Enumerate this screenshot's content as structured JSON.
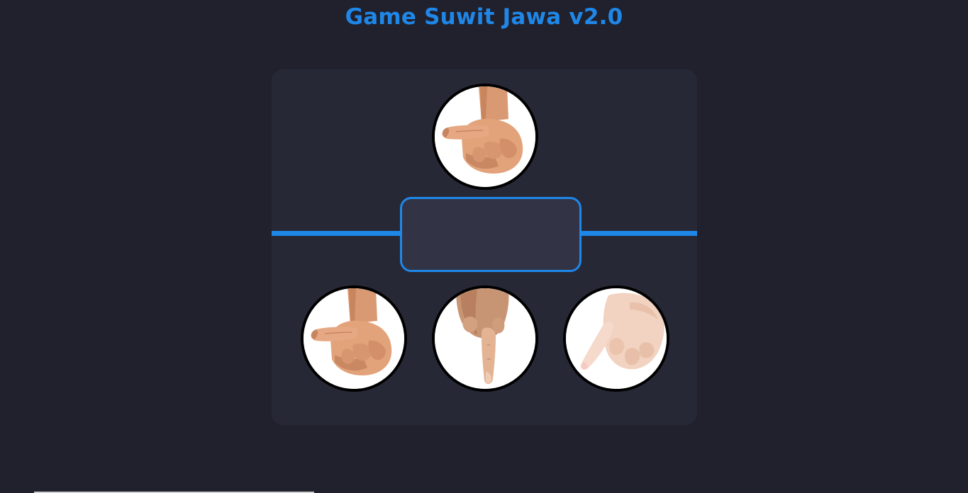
{
  "header": {
    "title": "Game Suwit Jawa v2.0"
  },
  "computer": {
    "choice_icon": "gajah-thumb-icon"
  },
  "result": {
    "text": ""
  },
  "player": {
    "choices": [
      {
        "icon": "gajah-thumb-icon"
      },
      {
        "icon": "orang-index-finger-icon"
      },
      {
        "icon": "semut-pinky-finger-icon"
      }
    ]
  },
  "colors": {
    "accent": "#1f87e8",
    "background": "#20212d",
    "board": "#272836",
    "result_box": "#323446"
  }
}
